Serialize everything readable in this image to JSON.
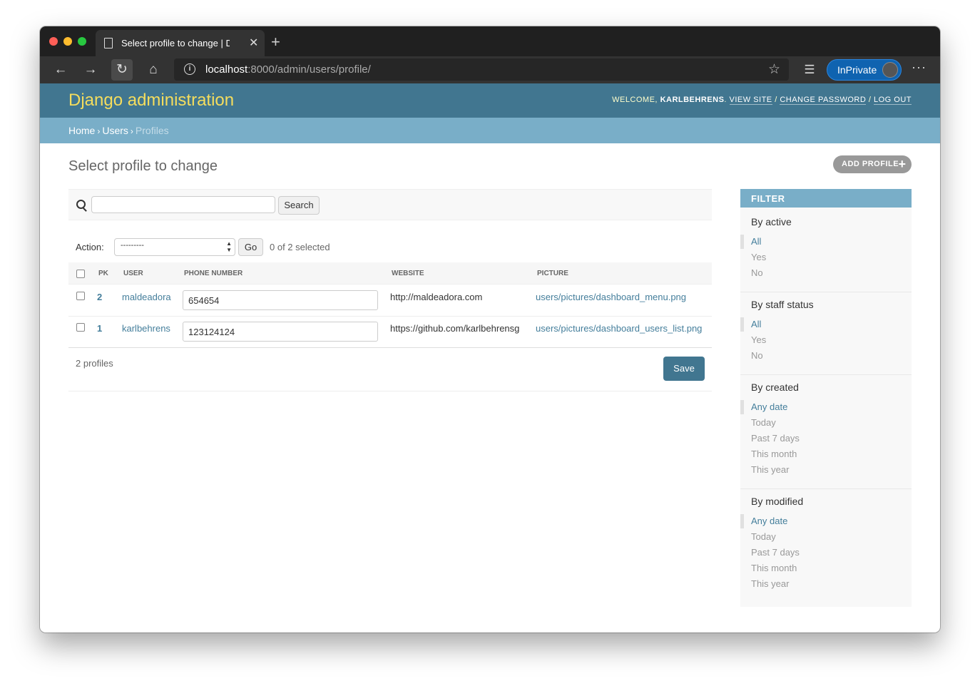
{
  "browser": {
    "tab_title": "Select profile to change | Django",
    "url_host": "localhost",
    "url_rest": ":8000/admin/users/profile/",
    "inprivate_label": "InPrivate"
  },
  "header": {
    "branding": "Django administration",
    "welcome": "Welcome,",
    "username": "karlbehrens",
    "view_site": "View site",
    "change_password": "Change password",
    "log_out": "Log out"
  },
  "breadcrumbs": {
    "home": "Home",
    "users": "Users",
    "current": "Profiles"
  },
  "page": {
    "title": "Select profile to change",
    "add_button": "ADD PROFILE",
    "search_button": "Search",
    "action_label": "Action:",
    "action_selected": "---------",
    "go_button": "Go",
    "selected_count": "0 of 2 selected",
    "paginator": "2 profiles",
    "save_button": "Save"
  },
  "table": {
    "headers": {
      "pk": "PK",
      "user": "USER",
      "phone": "PHONE NUMBER",
      "website": "WEBSITE",
      "picture": "PICTURE"
    },
    "rows": [
      {
        "pk": "2",
        "user": "maldeadora",
        "phone": "654654",
        "website": "http://maldeadora.com",
        "picture": "users/pictures/dashboard_menu.png"
      },
      {
        "pk": "1",
        "user": "karlbehrens",
        "phone": "123124124",
        "website": "https://github.com/karlbehrensg",
        "picture": "users/pictures/dashboard_users_list.png"
      }
    ]
  },
  "filter": {
    "title": "FILTER",
    "groups": [
      {
        "title": "By active",
        "items": [
          "All",
          "Yes",
          "No"
        ]
      },
      {
        "title": "By staff status",
        "items": [
          "All",
          "Yes",
          "No"
        ]
      },
      {
        "title": "By created",
        "items": [
          "Any date",
          "Today",
          "Past 7 days",
          "This month",
          "This year"
        ]
      },
      {
        "title": "By modified",
        "items": [
          "Any date",
          "Today",
          "Past 7 days",
          "This month",
          "This year"
        ]
      }
    ]
  },
  "colors": {
    "header_bg": "#417690",
    "breadcrumb_bg": "#79aec8",
    "branding": "#f5dd5d",
    "link": "#447e9b",
    "save_button": "#417690"
  }
}
